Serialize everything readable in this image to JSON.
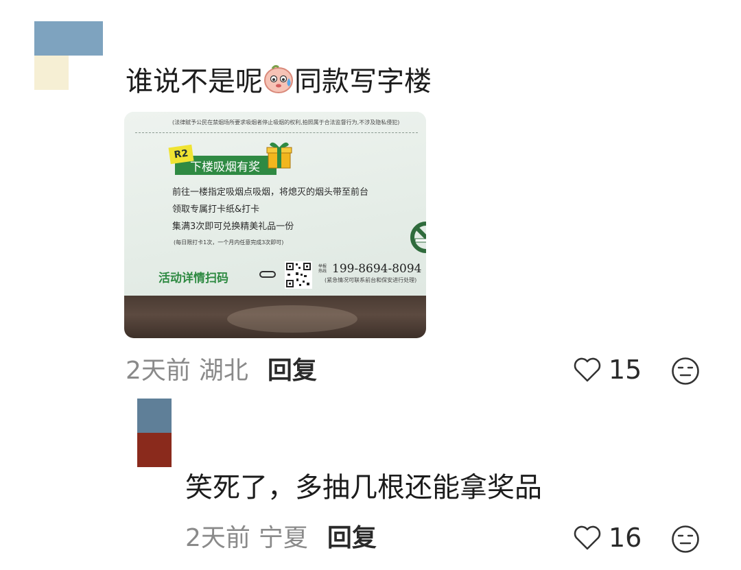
{
  "comments": [
    {
      "text_before_emoji": "谁说不是呢",
      "emoji_icon": "sweating-face-emoji",
      "text_after_emoji": "同款写字楼",
      "time": "2天前",
      "location": "湖北",
      "reply_label": "回复",
      "likes": "15",
      "avatar_colors": [
        "#7ea3bf",
        "#f6efd4"
      ],
      "photo": {
        "legal_note": "(法律赋予公民在禁烟场所要求吸烟者停止吸烟的权利,拍照属于合法监督行为,不涉及隐私侵犯)",
        "badge": "R2",
        "title": "下楼吸烟有奖",
        "lines": [
          "前往一楼指定吸烟点吸烟，将熄灭的烟头带至前台",
          "领取专属打卡纸&打卡",
          "集满3次即可兑换精美礼品一份"
        ],
        "note": "(每日限打卡1次，一个月内任意完成3次即可)",
        "scan_label": "活动详情扫码",
        "hotline_label": "举报热线",
        "phone": "199-8694-8094",
        "urgent_note": "(紧急情况可联系前台和保安进行处理)"
      }
    },
    {
      "text": "笑死了，多抽几根还能拿奖品",
      "time": "2天前",
      "location": "宁夏",
      "reply_label": "回复",
      "likes": "16",
      "avatar_colors": [
        "#5f7f98",
        "#8a2a1c"
      ]
    }
  ],
  "icons": {
    "like": "heart-outline-icon",
    "reaction": "neutral-face-icon",
    "gift": "gift-box-icon",
    "no_smoking": "no-smoking-icon",
    "qr": "qr-code-icon"
  }
}
